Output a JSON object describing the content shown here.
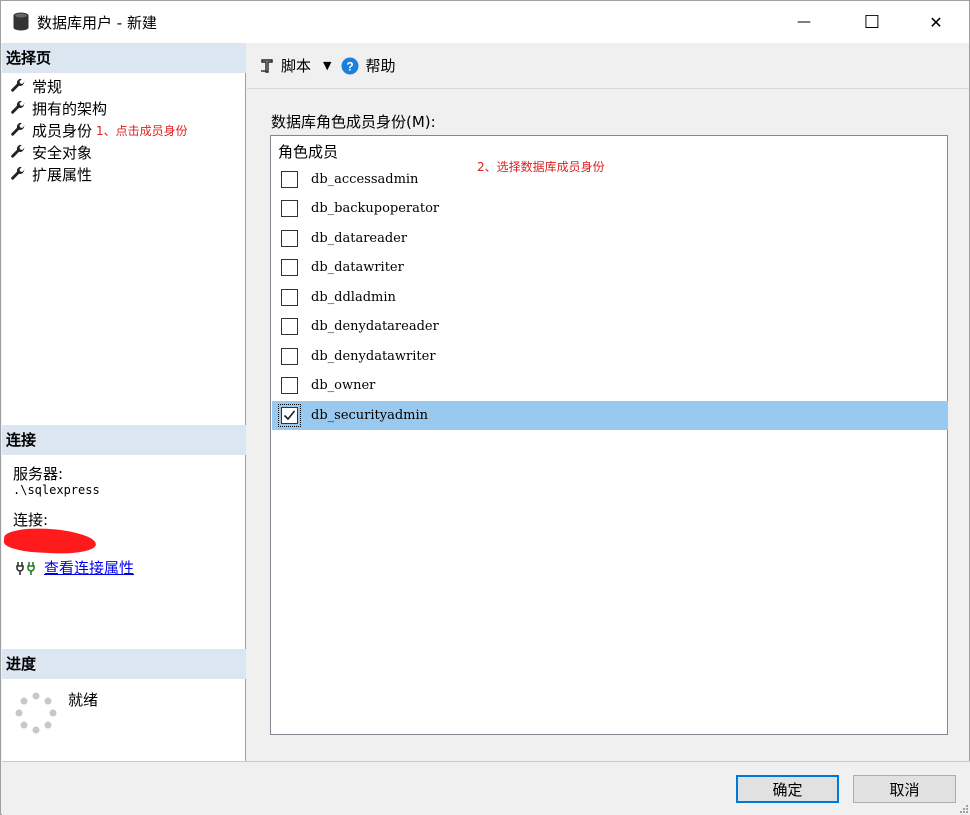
{
  "window": {
    "title": "数据库用户 - 新建",
    "minimize_glyph": "—",
    "maximize_glyph": "☐",
    "close_glyph": "✕"
  },
  "left": {
    "select_page_header": "选择页",
    "nav_items": [
      {
        "label": "常规",
        "icon": "wrench-icon"
      },
      {
        "label": "拥有的架构",
        "icon": "wrench-icon"
      },
      {
        "label": "成员身份",
        "icon": "wrench-icon",
        "annotation": "1、点击成员身份"
      },
      {
        "label": "安全对象",
        "icon": "wrench-icon"
      },
      {
        "label": "扩展属性",
        "icon": "wrench-icon"
      }
    ],
    "connection_header": "连接",
    "server_label": "服务器:",
    "server_value": ".\\sqlexpress",
    "connection_label": "连接:",
    "view_connection_link": "查看连接属性",
    "progress_header": "进度",
    "progress_status": "就绪"
  },
  "toolbar": {
    "script_label": "脚本",
    "help_label": "帮助"
  },
  "main": {
    "list_label": "数据库角色成员身份(M):",
    "column_header": "角色成员",
    "annotation": "2、选择数据库成员身份",
    "roles": [
      {
        "name": "db_accessadmin",
        "checked": false,
        "selected": false
      },
      {
        "name": "db_backupoperator",
        "checked": false,
        "selected": false
      },
      {
        "name": "db_datareader",
        "checked": false,
        "selected": false
      },
      {
        "name": "db_datawriter",
        "checked": false,
        "selected": false
      },
      {
        "name": "db_ddladmin",
        "checked": false,
        "selected": false
      },
      {
        "name": "db_denydatareader",
        "checked": false,
        "selected": false
      },
      {
        "name": "db_denydatawriter",
        "checked": false,
        "selected": false
      },
      {
        "name": "db_owner",
        "checked": false,
        "selected": false
      },
      {
        "name": "db_securityadmin",
        "checked": true,
        "selected": true
      }
    ]
  },
  "buttons": {
    "ok": "确定",
    "cancel": "取消"
  },
  "colors": {
    "selection": "#99c9ef",
    "section_header": "#dbe6f1",
    "annotation": "#e02020",
    "link": "#0000ee",
    "default_button_border": "#0078d7"
  }
}
